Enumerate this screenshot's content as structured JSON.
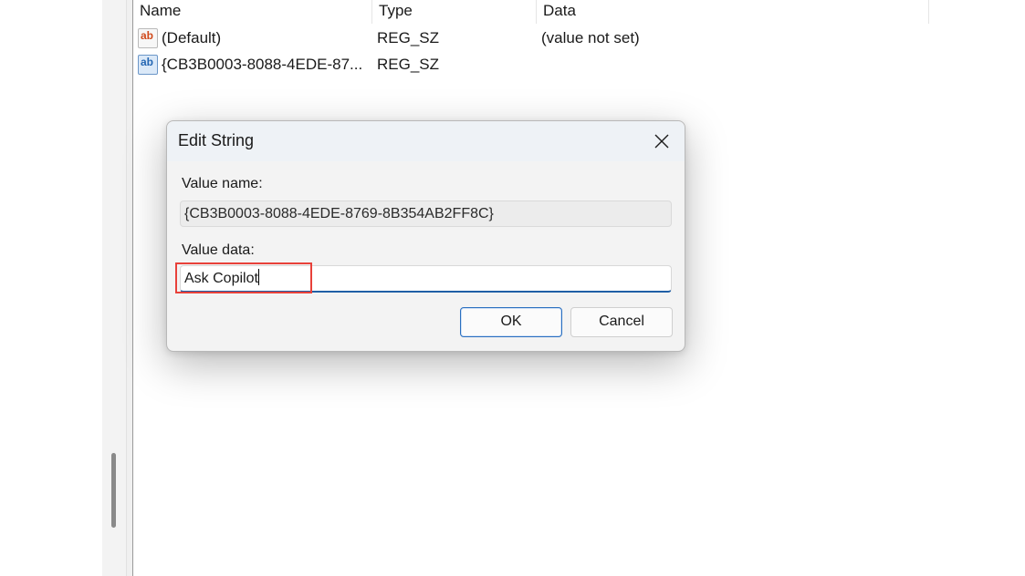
{
  "list": {
    "columns": [
      "Name",
      "Type",
      "Data"
    ],
    "rows": [
      {
        "name": "(Default)",
        "type": "REG_SZ",
        "data": "(value not set)",
        "icon": "string-value-icon"
      },
      {
        "name": "{CB3B0003-8088-4EDE-87...",
        "type": "REG_SZ",
        "data": "",
        "icon": "string-value-icon-selected"
      }
    ]
  },
  "dialog": {
    "title": "Edit String",
    "value_name_label": "Value name:",
    "value_name": "{CB3B0003-8088-4EDE-8769-8B354AB2FF8C}",
    "value_data_label": "Value data:",
    "value_data": "Ask Copilot",
    "ok_label": "OK",
    "cancel_label": "Cancel",
    "highlight_color": "#e8413a",
    "focus_color": "#1f5fa6"
  }
}
